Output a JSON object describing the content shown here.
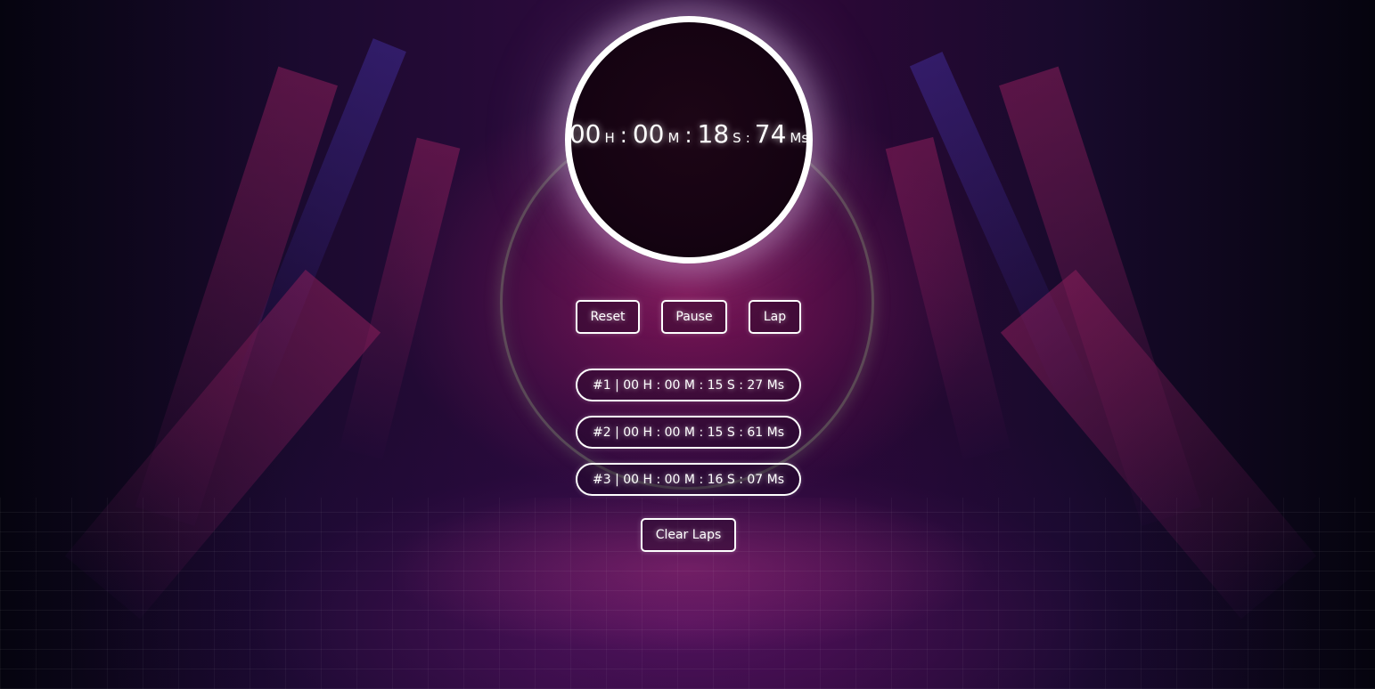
{
  "stopwatch": {
    "hours": "00",
    "hours_unit": "H",
    "minutes": "00",
    "minutes_unit": "M",
    "seconds": "18",
    "seconds_unit": "S",
    "milliseconds": "74",
    "milliseconds_unit": "Ms",
    "separator": ":"
  },
  "controls": {
    "reset_label": "Reset",
    "pause_label": "Pause",
    "lap_label": "Lap",
    "clear_laps_label": "Clear Laps"
  },
  "laps": [
    "#1 | 00 H : 00 M : 15 S : 27 Ms",
    "#2 | 00 H : 00 M : 15 S : 61 Ms",
    "#3 | 00 H : 00 M : 16 S : 07 Ms"
  ],
  "colors": {
    "accent": "#ffffff",
    "clock_face": "#150312",
    "glow": "#e6c8f0"
  }
}
